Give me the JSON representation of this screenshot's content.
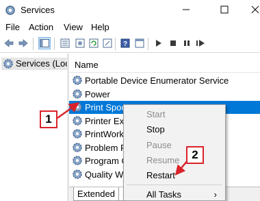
{
  "window": {
    "title": "Services"
  },
  "menu": {
    "file": "File",
    "action": "Action",
    "view": "View",
    "help": "Help"
  },
  "tree": {
    "root_label": "Services (Loca"
  },
  "list": {
    "column_name": "Name",
    "rows": [
      "Portable Device Enumerator Service",
      "Power",
      "Print Spoo",
      "Printer Ext",
      "PrintWork",
      "Problem R",
      "Program C",
      "Quality Wi"
    ],
    "selected_index": 2
  },
  "tabs": {
    "extended": "Extended",
    "standard": "S"
  },
  "context_menu": {
    "start": "Start",
    "stop": "Stop",
    "pause": "Pause",
    "resume": "Resume",
    "restart": "Restart",
    "all_tasks": "All Tasks",
    "submenu_arrow": "›"
  },
  "callouts": {
    "one": "1",
    "two": "2"
  },
  "colors": {
    "selection": "#0078d7",
    "callout": "#d9232a",
    "gear": "#5f7fa7"
  },
  "icons": [
    "services-app-icon",
    "minimize-icon",
    "maximize-icon",
    "close-icon",
    "back-icon",
    "forward-icon",
    "gear-icon",
    "play-icon",
    "stop-icon",
    "pause-icon",
    "restart-icon"
  ]
}
